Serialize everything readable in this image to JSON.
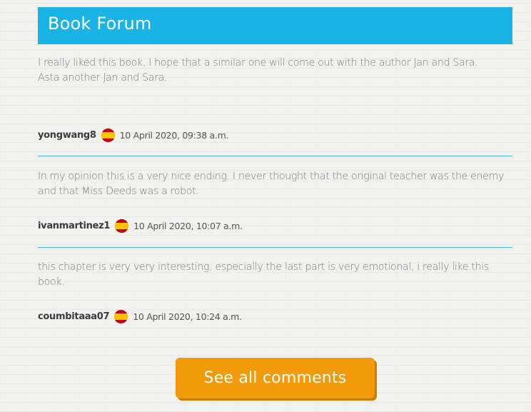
{
  "forum": {
    "title": "Book Forum",
    "comments": [
      {
        "lines": [
          "I really liked this book, I hope that a similar one will come out with the author Jan and Sara.",
          "Asta another Jan and Sara."
        ],
        "username": "yongwang8",
        "flag": "spain-flag-icon",
        "date": "10 April 2020, 09:38 a.m."
      },
      {
        "lines": [
          "In my opinion this is a very nice ending. I never thought that the original teacher was the enemy and that Miss Deeds was a robot."
        ],
        "username": "ivanmartinez1",
        "flag": "spain-flag-icon",
        "date": "10 April 2020, 10:07 a.m."
      },
      {
        "lines": [
          "this chapter is very very interesting, especially the last part is very emotional, i really like this book."
        ],
        "username": "coumbitaaa07",
        "flag": "spain-flag-icon",
        "date": "10 April 2020, 10:24 a.m."
      }
    ],
    "see_all_label": "See all comments"
  },
  "colors": {
    "header_bg": "#1ab3e6",
    "divider": "#4cc0e6",
    "button_bg": "#f29b0a",
    "flag_red": "#c6000f",
    "flag_yellow": "#ffc400"
  }
}
